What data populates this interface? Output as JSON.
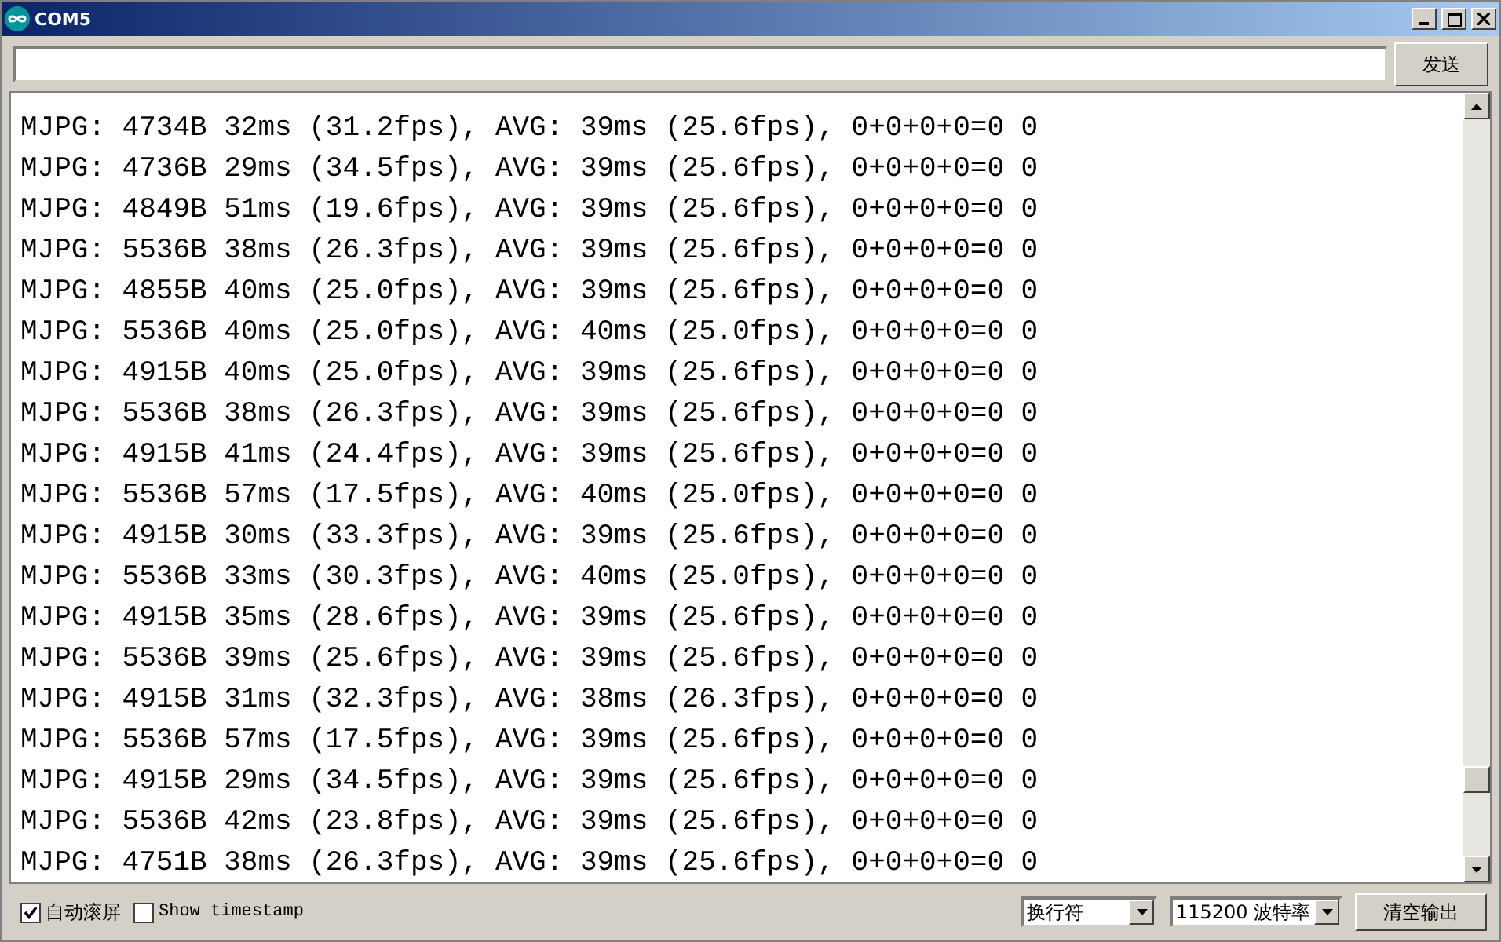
{
  "window": {
    "title": "COM5"
  },
  "send_button": "发送",
  "output_lines": [
    "MJPG: 4734B 32ms (31.2fps), AVG: 39ms (25.6fps), 0+0+0+0=0 0",
    "MJPG: 4736B 29ms (34.5fps), AVG: 39ms (25.6fps), 0+0+0+0=0 0",
    "MJPG: 4849B 51ms (19.6fps), AVG: 39ms (25.6fps), 0+0+0+0=0 0",
    "MJPG: 5536B 38ms (26.3fps), AVG: 39ms (25.6fps), 0+0+0+0=0 0",
    "MJPG: 4855B 40ms (25.0fps), AVG: 39ms (25.6fps), 0+0+0+0=0 0",
    "MJPG: 5536B 40ms (25.0fps), AVG: 40ms (25.0fps), 0+0+0+0=0 0",
    "MJPG: 4915B 40ms (25.0fps), AVG: 39ms (25.6fps), 0+0+0+0=0 0",
    "MJPG: 5536B 38ms (26.3fps), AVG: 39ms (25.6fps), 0+0+0+0=0 0",
    "MJPG: 4915B 41ms (24.4fps), AVG: 39ms (25.6fps), 0+0+0+0=0 0",
    "MJPG: 5536B 57ms (17.5fps), AVG: 40ms (25.0fps), 0+0+0+0=0 0",
    "MJPG: 4915B 30ms (33.3fps), AVG: 39ms (25.6fps), 0+0+0+0=0 0",
    "MJPG: 5536B 33ms (30.3fps), AVG: 40ms (25.0fps), 0+0+0+0=0 0",
    "MJPG: 4915B 35ms (28.6fps), AVG: 39ms (25.6fps), 0+0+0+0=0 0",
    "MJPG: 5536B 39ms (25.6fps), AVG: 39ms (25.6fps), 0+0+0+0=0 0",
    "MJPG: 4915B 31ms (32.3fps), AVG: 38ms (26.3fps), 0+0+0+0=0 0",
    "MJPG: 5536B 57ms (17.5fps), AVG: 39ms (25.6fps), 0+0+0+0=0 0",
    "MJPG: 4915B 29ms (34.5fps), AVG: 39ms (25.6fps), 0+0+0+0=0 0",
    "MJPG: 5536B 42ms (23.8fps), AVG: 39ms (25.6fps), 0+0+0+0=0 0",
    "MJPG: 4751B 38ms (26.3fps), AVG: 39ms (25.6fps), 0+0+0+0=0 0"
  ],
  "autoscroll": {
    "label": "自动滚屏",
    "checked": true
  },
  "timestamp": {
    "label": "Show timestamp",
    "checked": false
  },
  "line_ending": "换行符",
  "baud_rate": "115200 波特率",
  "clear_button": "清空输出"
}
